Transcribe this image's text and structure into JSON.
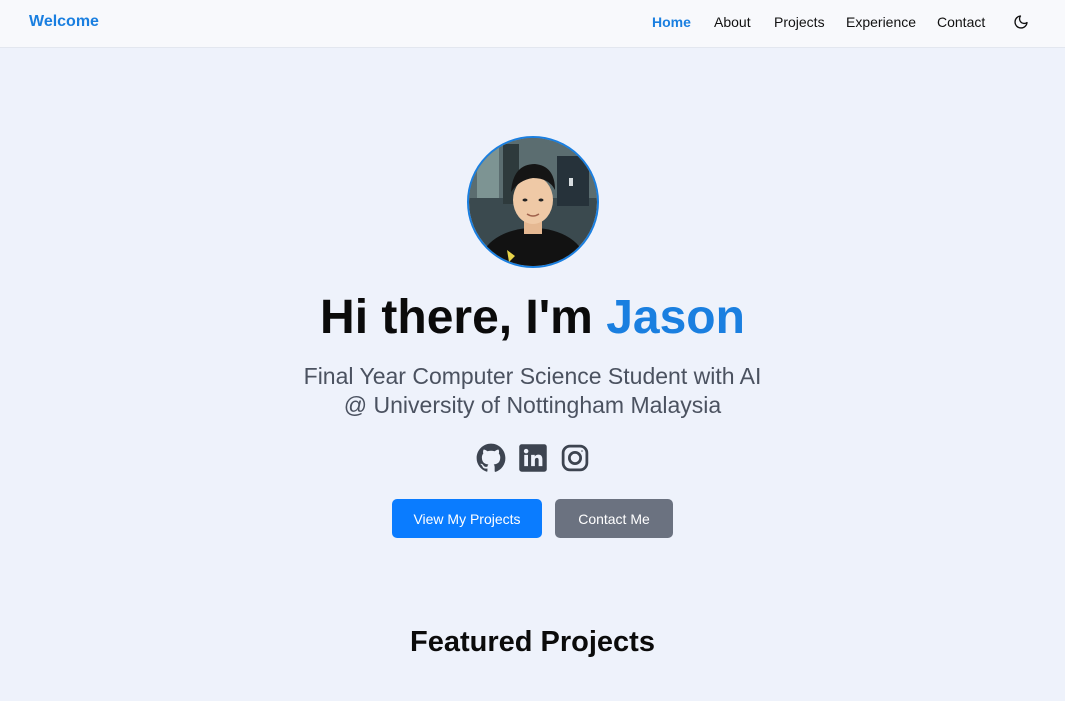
{
  "nav": {
    "brand": "Welcome",
    "links": [
      "Home",
      "About",
      "Projects",
      "Experience",
      "Contact"
    ],
    "active": "Home",
    "theme_toggle_icon": "moon-icon"
  },
  "hero": {
    "avatar_alt": "profile photo",
    "title_prefix": "Hi there, I'm ",
    "title_name": "Jason",
    "subtitle_line1": "Final Year Computer Science Student with AI",
    "subtitle_line2": "@ University of Nottingham Malaysia",
    "socials": [
      "github-icon",
      "linkedin-icon",
      "instagram-icon"
    ],
    "primary_button": "View My Projects",
    "secondary_button": "Contact Me"
  },
  "sections": {
    "featured_title": "Featured Projects"
  },
  "colors": {
    "accent": "#1a7fe0",
    "primary_button": "#0a7cff",
    "secondary_button": "#6b7280",
    "background": "#eef2fb"
  }
}
